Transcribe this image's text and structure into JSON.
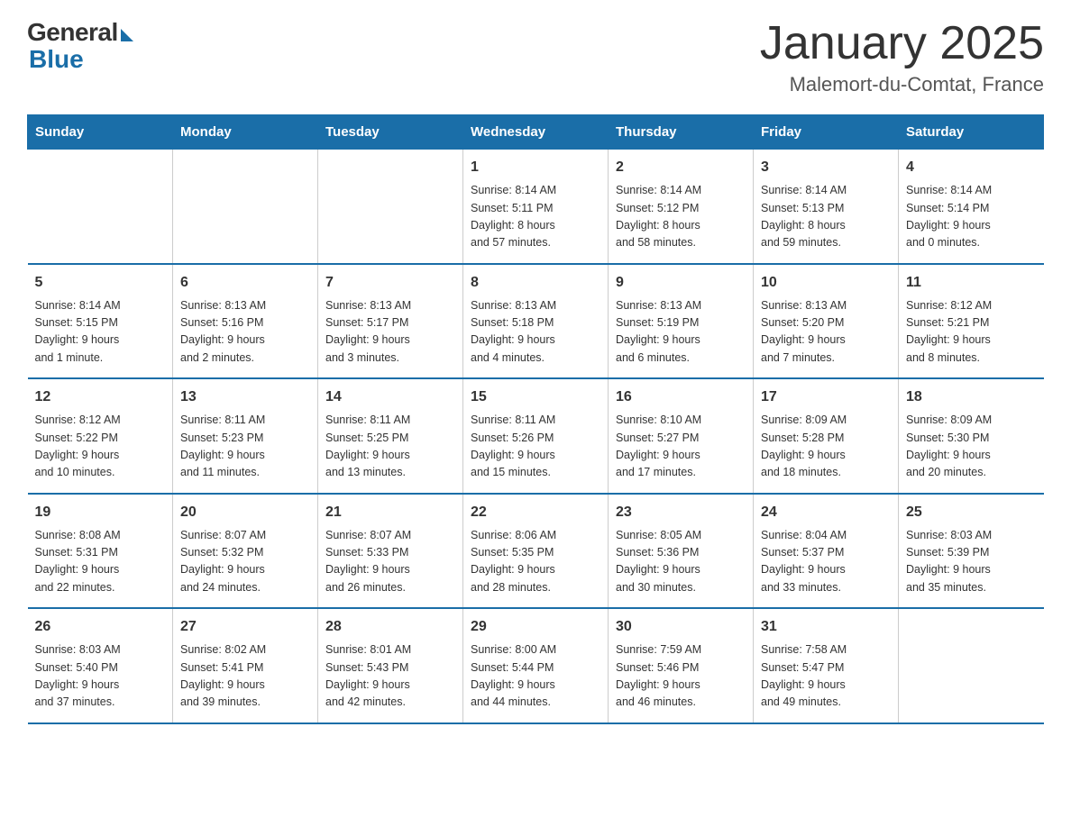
{
  "logo": {
    "general": "General",
    "blue": "Blue"
  },
  "title": "January 2025",
  "location": "Malemort-du-Comtat, France",
  "headers": [
    "Sunday",
    "Monday",
    "Tuesday",
    "Wednesday",
    "Thursday",
    "Friday",
    "Saturday"
  ],
  "weeks": [
    [
      {
        "day": "",
        "info": ""
      },
      {
        "day": "",
        "info": ""
      },
      {
        "day": "",
        "info": ""
      },
      {
        "day": "1",
        "info": "Sunrise: 8:14 AM\nSunset: 5:11 PM\nDaylight: 8 hours\nand 57 minutes."
      },
      {
        "day": "2",
        "info": "Sunrise: 8:14 AM\nSunset: 5:12 PM\nDaylight: 8 hours\nand 58 minutes."
      },
      {
        "day": "3",
        "info": "Sunrise: 8:14 AM\nSunset: 5:13 PM\nDaylight: 8 hours\nand 59 minutes."
      },
      {
        "day": "4",
        "info": "Sunrise: 8:14 AM\nSunset: 5:14 PM\nDaylight: 9 hours\nand 0 minutes."
      }
    ],
    [
      {
        "day": "5",
        "info": "Sunrise: 8:14 AM\nSunset: 5:15 PM\nDaylight: 9 hours\nand 1 minute."
      },
      {
        "day": "6",
        "info": "Sunrise: 8:13 AM\nSunset: 5:16 PM\nDaylight: 9 hours\nand 2 minutes."
      },
      {
        "day": "7",
        "info": "Sunrise: 8:13 AM\nSunset: 5:17 PM\nDaylight: 9 hours\nand 3 minutes."
      },
      {
        "day": "8",
        "info": "Sunrise: 8:13 AM\nSunset: 5:18 PM\nDaylight: 9 hours\nand 4 minutes."
      },
      {
        "day": "9",
        "info": "Sunrise: 8:13 AM\nSunset: 5:19 PM\nDaylight: 9 hours\nand 6 minutes."
      },
      {
        "day": "10",
        "info": "Sunrise: 8:13 AM\nSunset: 5:20 PM\nDaylight: 9 hours\nand 7 minutes."
      },
      {
        "day": "11",
        "info": "Sunrise: 8:12 AM\nSunset: 5:21 PM\nDaylight: 9 hours\nand 8 minutes."
      }
    ],
    [
      {
        "day": "12",
        "info": "Sunrise: 8:12 AM\nSunset: 5:22 PM\nDaylight: 9 hours\nand 10 minutes."
      },
      {
        "day": "13",
        "info": "Sunrise: 8:11 AM\nSunset: 5:23 PM\nDaylight: 9 hours\nand 11 minutes."
      },
      {
        "day": "14",
        "info": "Sunrise: 8:11 AM\nSunset: 5:25 PM\nDaylight: 9 hours\nand 13 minutes."
      },
      {
        "day": "15",
        "info": "Sunrise: 8:11 AM\nSunset: 5:26 PM\nDaylight: 9 hours\nand 15 minutes."
      },
      {
        "day": "16",
        "info": "Sunrise: 8:10 AM\nSunset: 5:27 PM\nDaylight: 9 hours\nand 17 minutes."
      },
      {
        "day": "17",
        "info": "Sunrise: 8:09 AM\nSunset: 5:28 PM\nDaylight: 9 hours\nand 18 minutes."
      },
      {
        "day": "18",
        "info": "Sunrise: 8:09 AM\nSunset: 5:30 PM\nDaylight: 9 hours\nand 20 minutes."
      }
    ],
    [
      {
        "day": "19",
        "info": "Sunrise: 8:08 AM\nSunset: 5:31 PM\nDaylight: 9 hours\nand 22 minutes."
      },
      {
        "day": "20",
        "info": "Sunrise: 8:07 AM\nSunset: 5:32 PM\nDaylight: 9 hours\nand 24 minutes."
      },
      {
        "day": "21",
        "info": "Sunrise: 8:07 AM\nSunset: 5:33 PM\nDaylight: 9 hours\nand 26 minutes."
      },
      {
        "day": "22",
        "info": "Sunrise: 8:06 AM\nSunset: 5:35 PM\nDaylight: 9 hours\nand 28 minutes."
      },
      {
        "day": "23",
        "info": "Sunrise: 8:05 AM\nSunset: 5:36 PM\nDaylight: 9 hours\nand 30 minutes."
      },
      {
        "day": "24",
        "info": "Sunrise: 8:04 AM\nSunset: 5:37 PM\nDaylight: 9 hours\nand 33 minutes."
      },
      {
        "day": "25",
        "info": "Sunrise: 8:03 AM\nSunset: 5:39 PM\nDaylight: 9 hours\nand 35 minutes."
      }
    ],
    [
      {
        "day": "26",
        "info": "Sunrise: 8:03 AM\nSunset: 5:40 PM\nDaylight: 9 hours\nand 37 minutes."
      },
      {
        "day": "27",
        "info": "Sunrise: 8:02 AM\nSunset: 5:41 PM\nDaylight: 9 hours\nand 39 minutes."
      },
      {
        "day": "28",
        "info": "Sunrise: 8:01 AM\nSunset: 5:43 PM\nDaylight: 9 hours\nand 42 minutes."
      },
      {
        "day": "29",
        "info": "Sunrise: 8:00 AM\nSunset: 5:44 PM\nDaylight: 9 hours\nand 44 minutes."
      },
      {
        "day": "30",
        "info": "Sunrise: 7:59 AM\nSunset: 5:46 PM\nDaylight: 9 hours\nand 46 minutes."
      },
      {
        "day": "31",
        "info": "Sunrise: 7:58 AM\nSunset: 5:47 PM\nDaylight: 9 hours\nand 49 minutes."
      },
      {
        "day": "",
        "info": ""
      }
    ]
  ]
}
